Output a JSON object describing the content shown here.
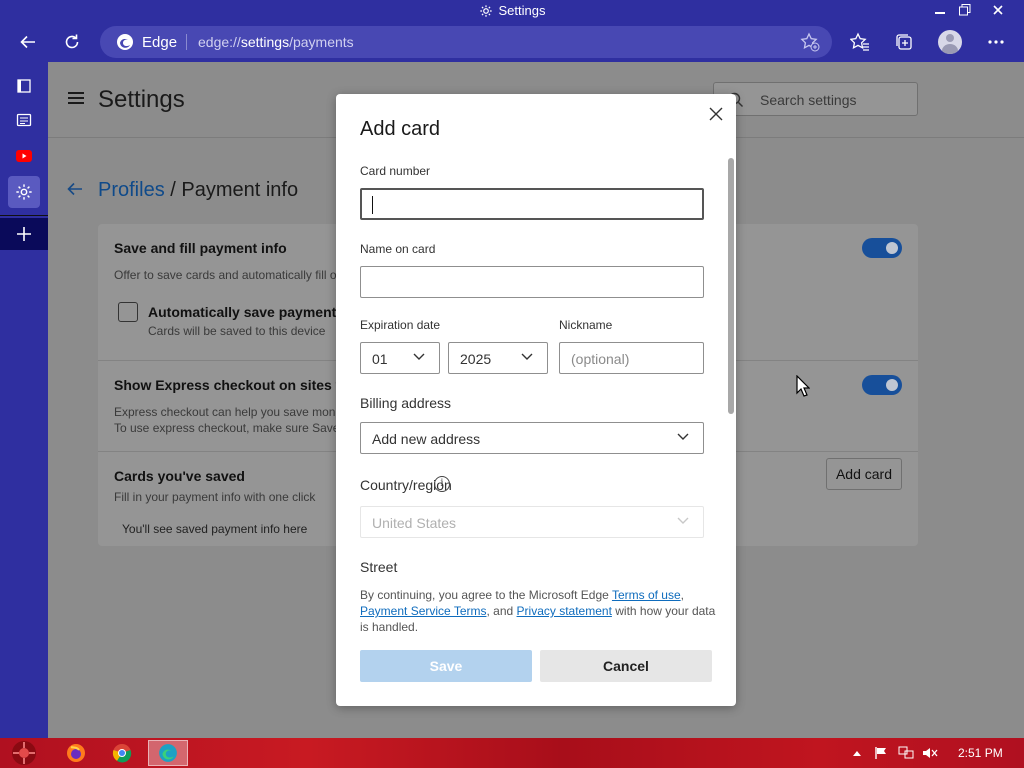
{
  "window": {
    "title": "Settings"
  },
  "toolbar": {
    "browser_name": "Edge",
    "url_prefix": "edge://",
    "url_host": "settings",
    "url_path": "/payments"
  },
  "settings": {
    "title": "Settings",
    "search_placeholder": "Search settings",
    "breadcrumb_parent": "Profiles",
    "breadcrumb_separator": " / ",
    "breadcrumb_current": "Payment info",
    "sections": {
      "save_fill_title": "Save and fill payment info",
      "save_fill_desc": "Offer to save cards and automatically fill o",
      "auto_save_title": "Automatically save payment i",
      "auto_save_desc": "Cards will be saved to this device",
      "express_title": "Show Express checkout on sites wh",
      "express_desc_1": "Express checkout can help you save mone",
      "express_desc_2": "To use express checkout, make sure Save a",
      "saved_title": "Cards you've saved",
      "saved_desc": "Fill in your payment info with one click",
      "saved_empty": "You'll see saved payment info here",
      "add_card_button": "Add card"
    },
    "toggles": {
      "save_fill_on": true,
      "express_on": true
    }
  },
  "modal": {
    "title": "Add card",
    "card_number_label": "Card number",
    "card_number_value": "",
    "name_label": "Name on card",
    "name_value": "",
    "expiration_label": "Expiration date",
    "expiration_month": "01",
    "expiration_year": "2025",
    "nickname_label": "Nickname",
    "nickname_placeholder": "(optional)",
    "billing_label": "Billing address",
    "billing_value": "Add new address",
    "country_label": "Country/region",
    "country_value": "United States",
    "street_label": "Street",
    "terms_prefix": "By continuing, you agree to the Microsoft Edge ",
    "terms_link": "Terms of use",
    "terms_comma": ", ",
    "pst_link": "Payment Service Terms",
    "terms_and": ", and ",
    "privacy_link": "Privacy statement",
    "terms_suffix": " with how your data is handled.",
    "save_button": "Save",
    "cancel_button": "Cancel"
  },
  "taskbar": {
    "clock": "2:51 PM"
  },
  "colors": {
    "chrome_bg": "#2f2fa0",
    "accent": "#0f6cbd",
    "taskbar": "#c0151f"
  }
}
